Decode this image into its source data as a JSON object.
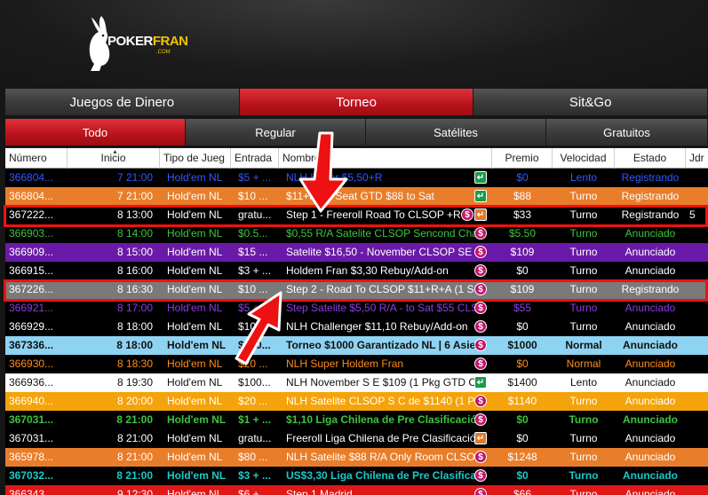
{
  "brand": {
    "name_part1": "POKER",
    "name_part2": "FRAN",
    "sub": ".COM"
  },
  "tabs": [
    {
      "label": "Juegos de Dinero",
      "active": false
    },
    {
      "label": "Torneo",
      "active": true
    },
    {
      "label": "Sit&Go",
      "active": false
    }
  ],
  "subtabs": [
    {
      "label": "Todo",
      "active": true
    },
    {
      "label": "Regular",
      "active": false
    },
    {
      "label": "Satélites",
      "active": false
    },
    {
      "label": "Gratuitos",
      "active": false
    }
  ],
  "columns": {
    "numero": "Número",
    "inicio": "Inicio",
    "tipo": "Tipo de Jueg",
    "entrada": "Entrada",
    "nombre": "Nombre",
    "premio": "Premio",
    "velocidad": "Velocidad",
    "estado": "Estado",
    "jd": "Jdr"
  },
  "colors": {
    "accent": "#c4141c",
    "orange": "#e87d2a",
    "purple": "#6a1aa8",
    "light_blue": "#8fd3f2",
    "highlight": "#ee1111"
  },
  "rows": [
    {
      "num": "366804...",
      "inicio": "7 21:00",
      "tipo": "Hold'em NL",
      "entrada": "$5 + ...",
      "nombre": "NLH Hyper $5,50+R",
      "premio": "$0",
      "velocidad": "Lento",
      "estado": "Registrando",
      "jd": "",
      "bg": "#000000",
      "fg": "#2f59ff",
      "bold": false,
      "icon": "green"
    },
    {
      "num": "366804...",
      "inicio": "7 21:00",
      "tipo": "Hold'em NL",
      "entrada": "$10 ...",
      "nombre": "$11+R - 1 Seat GTD $88  to Sat",
      "premio": "$88",
      "velocidad": "Turno",
      "estado": "Registrando",
      "jd": "",
      "bg": "#e87d2a",
      "fg": "#ffffff",
      "bold": false,
      "icon": "green"
    },
    {
      "num": "367222...",
      "inicio": "8 13:00",
      "tipo": "Hold'em NL",
      "entrada": "gratu...",
      "nombre": "Step 1 - Freeroll Road To CLSOP +R",
      "premio": "$33",
      "velocidad": "Turno",
      "estado": "Registrando",
      "jd": "5",
      "bg": "#000000",
      "fg": "#ffffff",
      "bold": false,
      "icon": "orange",
      "icon2": "dollar"
    },
    {
      "num": "366903...",
      "inicio": "8 14:00",
      "tipo": "Hold'em NL",
      "entrada": "$0.5...",
      "nombre": "$0,55 R/A Satelite CLSOP Sencond Cha",
      "premio": "$5.50",
      "velocidad": "Turno",
      "estado": "Anunciado",
      "jd": "",
      "bg": "#000000",
      "fg": "#3ec43e",
      "bold": false,
      "icon": "dollar"
    },
    {
      "num": "366909...",
      "inicio": "8 15:00",
      "tipo": "Hold'em NL",
      "entrada": "$15 ...",
      "nombre": "Satelite $16,50 - November CLSOP SE L",
      "premio": "$109",
      "velocidad": "Turno",
      "estado": "Anunciado",
      "jd": "",
      "bg": "#6a1aa8",
      "fg": "#ffffff",
      "bold": false,
      "icon": "dollar"
    },
    {
      "num": "366915...",
      "inicio": "8 16:00",
      "tipo": "Hold'em NL",
      "entrada": "$3 + ...",
      "nombre": "Holdem Fran $3,30 Rebuy/Add-on",
      "premio": "$0",
      "velocidad": "Turno",
      "estado": "Anunciado",
      "jd": "",
      "bg": "#000000",
      "fg": "#ffffff",
      "bold": false,
      "icon": "dollar"
    },
    {
      "num": "367226...",
      "inicio": "8 16:30",
      "tipo": "Hold'em NL",
      "entrada": "$10 ...",
      "nombre": "Step 2 - Road To CLSOP $11+R+A (1 Se",
      "premio": "$109",
      "velocidad": "Turno",
      "estado": "Registrando",
      "jd": "",
      "bg": "#7a7a7a",
      "fg": "#ffffff",
      "bold": false,
      "icon": "dollar"
    },
    {
      "num": "366921...",
      "inicio": "8 17:00",
      "tipo": "Hold'em NL",
      "entrada": "$5 + ...",
      "nombre": "Step Satelite $5,50 R/A - to Sat $55 CLS",
      "premio": "$55",
      "velocidad": "Turno",
      "estado": "Anunciado",
      "jd": "",
      "bg": "#000000",
      "fg": "#8a3ce0",
      "bold": false,
      "icon": "dollar"
    },
    {
      "num": "366929...",
      "inicio": "8 18:00",
      "tipo": "Hold'em NL",
      "entrada": "$10 ...",
      "nombre": "NLH Challenger $11,10 Rebuy/Add-on",
      "premio": "$0",
      "velocidad": "Turno",
      "estado": "Anunciado",
      "jd": "",
      "bg": "#000000",
      "fg": "#ffffff",
      "bold": false,
      "icon": "dollar"
    },
    {
      "num": "367336...",
      "inicio": "8 18:00",
      "tipo": "Hold'em NL",
      "entrada": "$950...",
      "nombre": "Torneo $1000 Garantizado NL | 6 Asient",
      "premio": "$1000",
      "velocidad": "Normal",
      "estado": "Anunciado",
      "jd": "",
      "bg": "#8fd3f2",
      "fg": "#111111",
      "bold": true,
      "icon": "dollar"
    },
    {
      "num": "366930...",
      "inicio": "8 18:30",
      "tipo": "Hold'em NL",
      "entrada": "$20 ...",
      "nombre": "NLH Super Holdem Fran",
      "premio": "$0",
      "velocidad": "Normal",
      "estado": "Anunciado",
      "jd": "",
      "bg": "#000000",
      "fg": "#ff8c1a",
      "bold": false,
      "icon": "dollar"
    },
    {
      "num": "366936...",
      "inicio": "8 19:30",
      "tipo": "Hold'em NL",
      "entrada": "$100...",
      "nombre": "NLH November S E $109 (1 Pkg GTD CL",
      "premio": "$1400",
      "velocidad": "Lento",
      "estado": "Anunciado",
      "jd": "",
      "bg": "#ffffff",
      "fg": "#111111",
      "bold": false,
      "icon": "green"
    },
    {
      "num": "366940...",
      "inicio": "8 20:00",
      "tipo": "Hold'em NL",
      "entrada": "$20 ...",
      "nombre": "NLH Satelite CLSOP S C de $1140 (1 Pa",
      "premio": "$1140",
      "velocidad": "Turno",
      "estado": "Anunciado",
      "jd": "",
      "bg": "#f5a30a",
      "fg": "#ffffff",
      "bold": false,
      "icon": "dollar"
    },
    {
      "num": "367031...",
      "inicio": "8 21:00",
      "tipo": "Hold'em NL",
      "entrada": "$1 + ...",
      "nombre": "$1,10 Liga Chilena de Pre Clasificación",
      "premio": "$0",
      "velocidad": "Turno",
      "estado": "Anunciado",
      "jd": "",
      "bg": "#000000",
      "fg": "#3ec43e",
      "bold": true,
      "icon": "dollar"
    },
    {
      "num": "367031...",
      "inicio": "8 21:00",
      "tipo": "Hold'em NL",
      "entrada": "gratu...",
      "nombre": "Freeroll Liga Chilena de Pre Clasificació",
      "premio": "$0",
      "velocidad": "Turno",
      "estado": "Anunciado",
      "jd": "",
      "bg": "#000000",
      "fg": "#ffffff",
      "bold": false,
      "icon": "orange"
    },
    {
      "num": "365978...",
      "inicio": "8 21:00",
      "tipo": "Hold'em NL",
      "entrada": "$80 ...",
      "nombre": "NLH Satelite $88 R/A Only Room CLSO...",
      "premio": "$1248",
      "velocidad": "Turno",
      "estado": "Anunciado",
      "jd": "",
      "bg": "#e87d2a",
      "fg": "#ffffff",
      "bold": false,
      "icon": "dollar"
    },
    {
      "num": "367032...",
      "inicio": "8 21:00",
      "tipo": "Hold'em NL",
      "entrada": "$3 + ...",
      "nombre": "US$3,30 Liga Chilena de Pre Clasificaci",
      "premio": "$0",
      "velocidad": "Turno",
      "estado": "Anunciado",
      "jd": "",
      "bg": "#000000",
      "fg": "#19c9c9",
      "bold": true,
      "icon": "dollar"
    },
    {
      "num": "366343...",
      "inicio": "9 12:30",
      "tipo": "Hold'em NL",
      "entrada": "$6 + ...",
      "nombre": "Step 1 Madrid",
      "premio": "$66",
      "velocidad": "Turno",
      "estado": "Anunciado",
      "jd": "",
      "bg": "#e01818",
      "fg": "#ffffff",
      "bold": false,
      "icon": "dollar"
    }
  ]
}
